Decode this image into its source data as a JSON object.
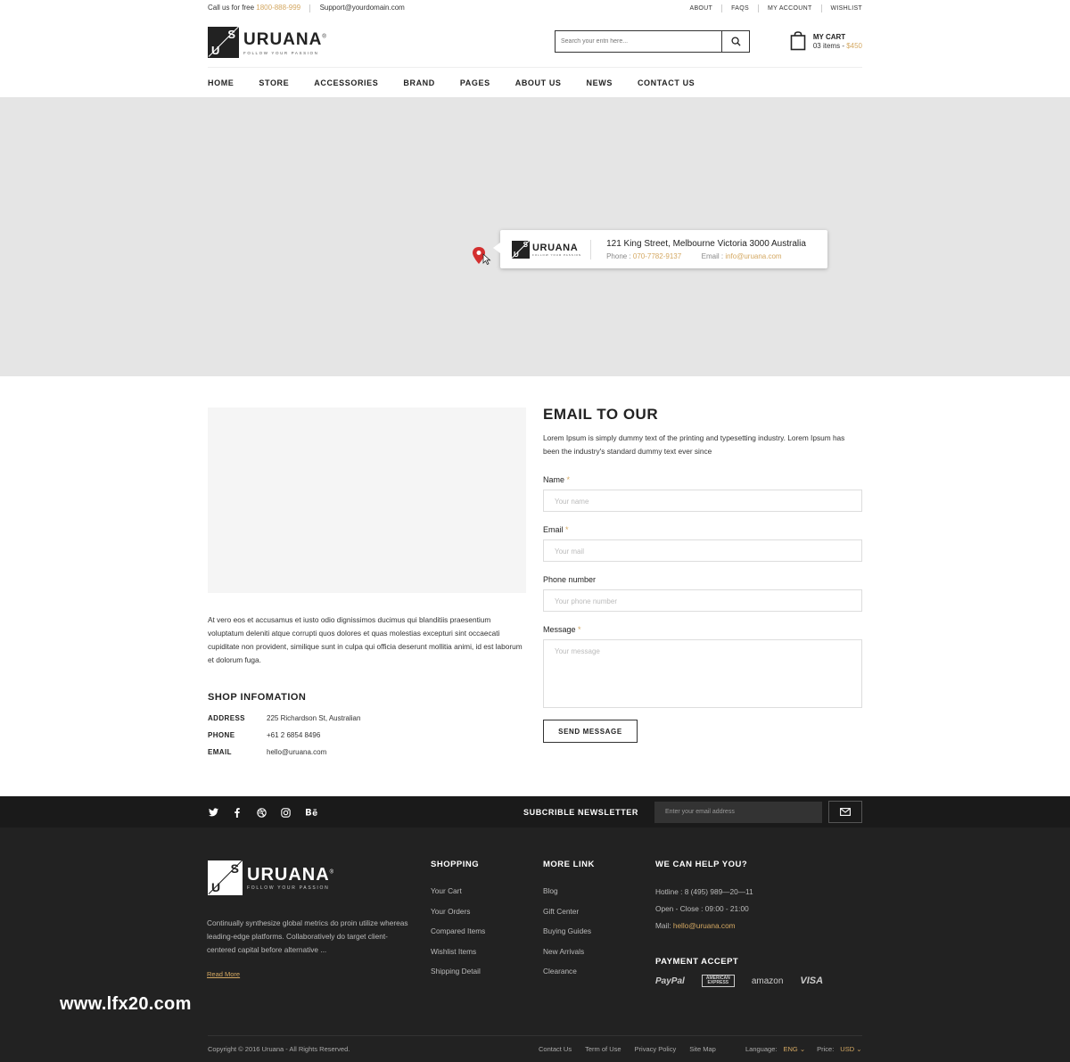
{
  "topbar": {
    "call_label": "Call us for free",
    "phone": "1800-888-999",
    "support": "Support@yourdomain.com",
    "links": [
      "ABOUT",
      "FAQS",
      "MY ACCOUNT",
      "WISHLIST"
    ]
  },
  "logo": {
    "name": "URUANA",
    "tagline": "FOLLOW YOUR PASSION",
    "letter_s": "S",
    "letter_u": "U",
    "reg": "®"
  },
  "search": {
    "placeholder": "Search your entri here..."
  },
  "cart": {
    "title": "MY CART",
    "items": "03 items - ",
    "total": "$450"
  },
  "nav": [
    "HOME",
    "STORE",
    "ACCESSORIES",
    "BRAND",
    "PAGES",
    "ABOUT US",
    "NEWS",
    "CONTACT US"
  ],
  "map": {
    "address": "121 King Street, Melbourne Victoria 3000 Australia",
    "phone_label": "Phone : ",
    "phone": "070-7782-9137",
    "email_label": "Email : ",
    "email": "info@uruana.com"
  },
  "about": {
    "text": "At vero eos et accusamus et iusto odio dignissimos ducimus qui blanditiis praesentium voluptatum deleniti atque corrupti quos dolores et quas molestias excepturi sint occaecati cupiditate non provident, similique sunt in culpa qui officia deserunt mollitia animi, id est laborum et dolorum fuga."
  },
  "shop": {
    "title": "SHOP INFOMATION",
    "rows": [
      {
        "k": "ADDRESS",
        "v": "225 Richardson St, Australian"
      },
      {
        "k": "PHONE",
        "v": "+61 2 6854 8496"
      },
      {
        "k": "EMAIL",
        "v": "hello@uruana.com"
      }
    ]
  },
  "form": {
    "title": "EMAIL TO OUR",
    "intro": "Lorem Ipsum is simply dummy text of the printing and typesetting industry. Lorem Ipsum has been the industry's standard dummy text ever since",
    "name_label": "Name",
    "name_ph": "Your name",
    "email_label": "Email",
    "email_ph": "Your mail",
    "phone_label": "Phone number",
    "phone_ph": "Your phone number",
    "message_label": "Message",
    "message_ph": "Your message",
    "required": "*",
    "submit": "SEND MESSAGE"
  },
  "newsletter": {
    "title": "SUBCRIBLE NEWSLETTER",
    "placeholder": "Enter your email address"
  },
  "social": [
    "twitter-icon",
    "facebook-icon",
    "dribbble-icon",
    "instagram-icon",
    "behance-icon"
  ],
  "footer": {
    "desc": "Continually synthesize global metrics do proin utilize whereas leading-edge platforms. Collaboratively do target client-centered capital before alternative ...",
    "read_more": "Read More",
    "shopping": {
      "title": "SHOPPING",
      "items": [
        "Your Cart",
        "Your Orders",
        "Compared Items",
        "Wishlist Items",
        "Shipping Detail"
      ]
    },
    "more": {
      "title": "MORE LINK",
      "items": [
        "Blog",
        "Gift Center",
        "Buying Guides",
        "New Arrivals",
        "Clearance"
      ]
    },
    "help": {
      "title": "WE CAN HELP YOU?",
      "hotline": "Hotline : 8 (495) 989—20—11",
      "hours": "Open - Close : 09:00 - 21:00",
      "mail_label": "Mail: ",
      "mail": "hello@uruana.com"
    },
    "payment": {
      "title": "PAYMENT ACCEPT",
      "methods": [
        "PayPal",
        "AMERICAN EXPRESS",
        "amazon",
        "VISA"
      ]
    },
    "copyright": "Copyright © 2016 Uruana - All Rights Reserved.",
    "links": [
      "Contact Us",
      "Term of Use",
      "Privacy Policy",
      "Site Map"
    ],
    "language_label": "Language:",
    "language": "ENG",
    "price_label": "Price:",
    "price": "USD"
  },
  "watermark": "www.lfx20.com",
  "colors": {
    "accent": "#d4a862",
    "dark": "#222222",
    "map": "#e5e5e5",
    "pin": "#d32f2f"
  }
}
